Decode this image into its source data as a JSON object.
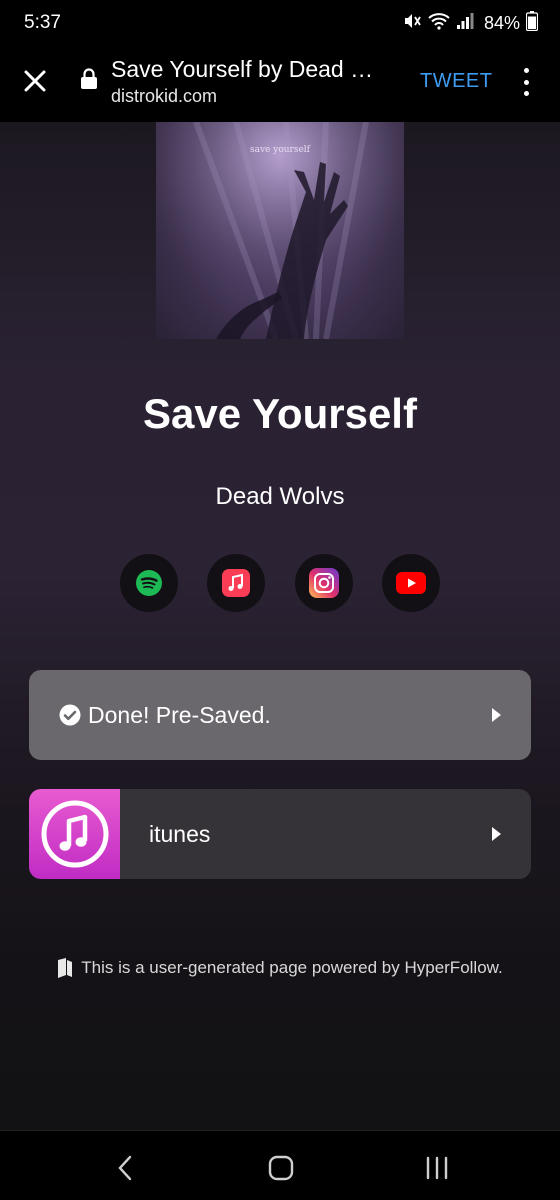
{
  "status_bar": {
    "time": "5:37",
    "battery": "84%",
    "icons": [
      "mute-icon",
      "wifi-icon",
      "signal-icon",
      "battery-icon"
    ]
  },
  "browser": {
    "title": "Save Yourself by Dead …",
    "url": "distrokid.com",
    "tweet_label": "TWEET",
    "close_icon": "close-icon",
    "lock_icon": "lock-icon",
    "menu_icon": "more-vert-icon"
  },
  "release": {
    "album_art_text": "save yourself",
    "title": "Save Yourself",
    "artist": "Dead Wolvs"
  },
  "social_links": [
    {
      "name": "spotify",
      "icon": "spotify-icon",
      "color": "#1DB954"
    },
    {
      "name": "apple-music",
      "icon": "apple-music-icon",
      "color": "#FA3C55"
    },
    {
      "name": "instagram",
      "icon": "instagram-icon",
      "color": "#E1306C"
    },
    {
      "name": "youtube",
      "icon": "youtube-icon",
      "color": "#FF0000"
    }
  ],
  "actions": {
    "presave_label": "Done! Pre-Saved.",
    "itunes_label": "itunes"
  },
  "footer": {
    "text": "This is a user-generated page powered by HyperFollow."
  },
  "nav": [
    "back-icon",
    "home-icon",
    "recents-icon"
  ],
  "colors": {
    "accent": "#3d9cf0",
    "presave_bg": "#6a676d",
    "itunes_bg": "#353338",
    "itunes_brand": "#d040c8"
  }
}
